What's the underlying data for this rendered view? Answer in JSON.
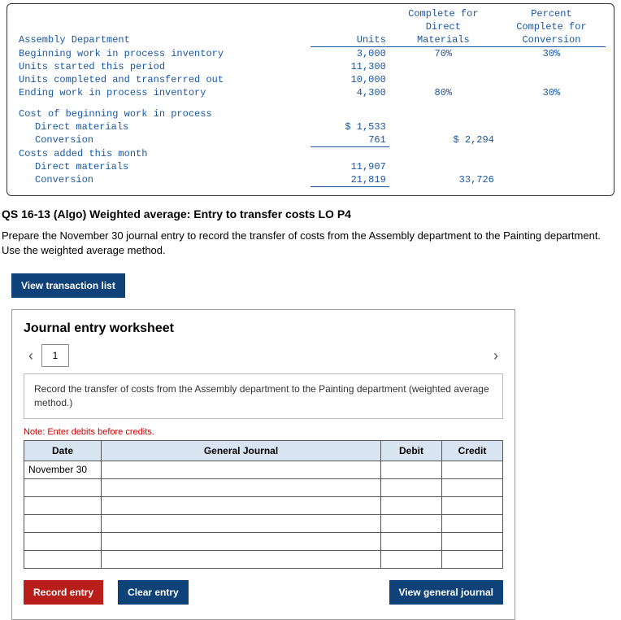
{
  "data_table": {
    "headers": {
      "units": "Units",
      "dm_line1": "Complete for",
      "dm_line2": "Direct",
      "dm_line3": "Materials",
      "cv_line1": "Percent",
      "cv_line2": "Complete for",
      "cv_line3": "Conversion"
    },
    "section1_title": "Assembly Department",
    "rows1": [
      {
        "label": "Beginning work in process inventory",
        "units": "3,000",
        "dm": "70%",
        "cv": "30%"
      },
      {
        "label": "Units started this period",
        "units": "11,300",
        "dm": "",
        "cv": ""
      },
      {
        "label": "Units completed and transferred out",
        "units": "10,000",
        "dm": "",
        "cv": ""
      },
      {
        "label": "Ending work in process inventory",
        "units": "4,300",
        "dm": "80%",
        "cv": "30%"
      }
    ],
    "section2_title": "Cost of beginning work in process",
    "rows2": [
      {
        "label": "Direct materials",
        "val": "$ 1,533",
        "sum": ""
      },
      {
        "label": "Conversion",
        "val": "761",
        "sum": "$ 2,294",
        "ul": true
      }
    ],
    "section3_title": "Costs added this month",
    "rows3": [
      {
        "label": "Direct materials",
        "val": "11,907",
        "sum": ""
      },
      {
        "label": "Conversion",
        "val": "21,819",
        "sum": "33,726",
        "ul": true
      }
    ]
  },
  "question": {
    "title": "QS 16-13 (Algo) Weighted average: Entry to transfer costs LO P4",
    "instructions": "Prepare the November 30 journal entry to record the transfer of costs from the Assembly department to the Painting department. Use the weighted average method."
  },
  "buttons": {
    "view_trans_list": "View transaction list",
    "record": "Record entry",
    "clear": "Clear entry",
    "view_journal": "View general journal"
  },
  "worksheet": {
    "title": "Journal entry worksheet",
    "tab": "1",
    "entry_desc": "Record the transfer of costs from the Assembly department to the Painting department (weighted average method.)",
    "note": "Note: Enter debits before credits.",
    "columns": {
      "date": "Date",
      "acct": "General Journal",
      "debit": "Debit",
      "credit": "Credit"
    },
    "rows": [
      {
        "date": "November 30",
        "acct": "",
        "debit": "",
        "credit": ""
      },
      {
        "date": "",
        "acct": "",
        "debit": "",
        "credit": ""
      },
      {
        "date": "",
        "acct": "",
        "debit": "",
        "credit": ""
      },
      {
        "date": "",
        "acct": "",
        "debit": "",
        "credit": ""
      },
      {
        "date": "",
        "acct": "",
        "debit": "",
        "credit": ""
      },
      {
        "date": "",
        "acct": "",
        "debit": "",
        "credit": ""
      }
    ]
  }
}
